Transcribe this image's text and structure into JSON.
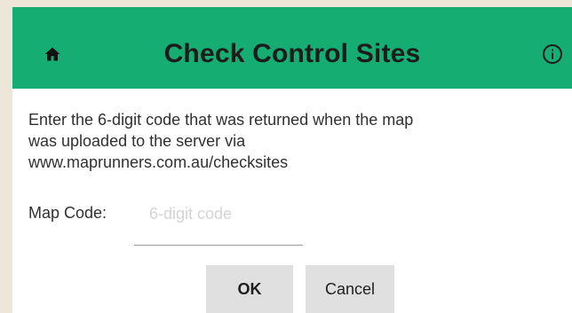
{
  "header": {
    "title": "Check Control Sites",
    "home_icon": "home-icon",
    "info_icon": "info-icon",
    "bg_color": "#16ad73"
  },
  "body": {
    "line1": "Enter the 6-digit code that was returned when the map",
    "line2": "was uploaded to the server via",
    "line3": "www.maprunners.com.au/checksites"
  },
  "form": {
    "code_label": "Map Code:",
    "code_value": "",
    "code_placeholder": "6-digit code"
  },
  "buttons": {
    "ok_label": "OK",
    "cancel_label": "Cancel"
  }
}
